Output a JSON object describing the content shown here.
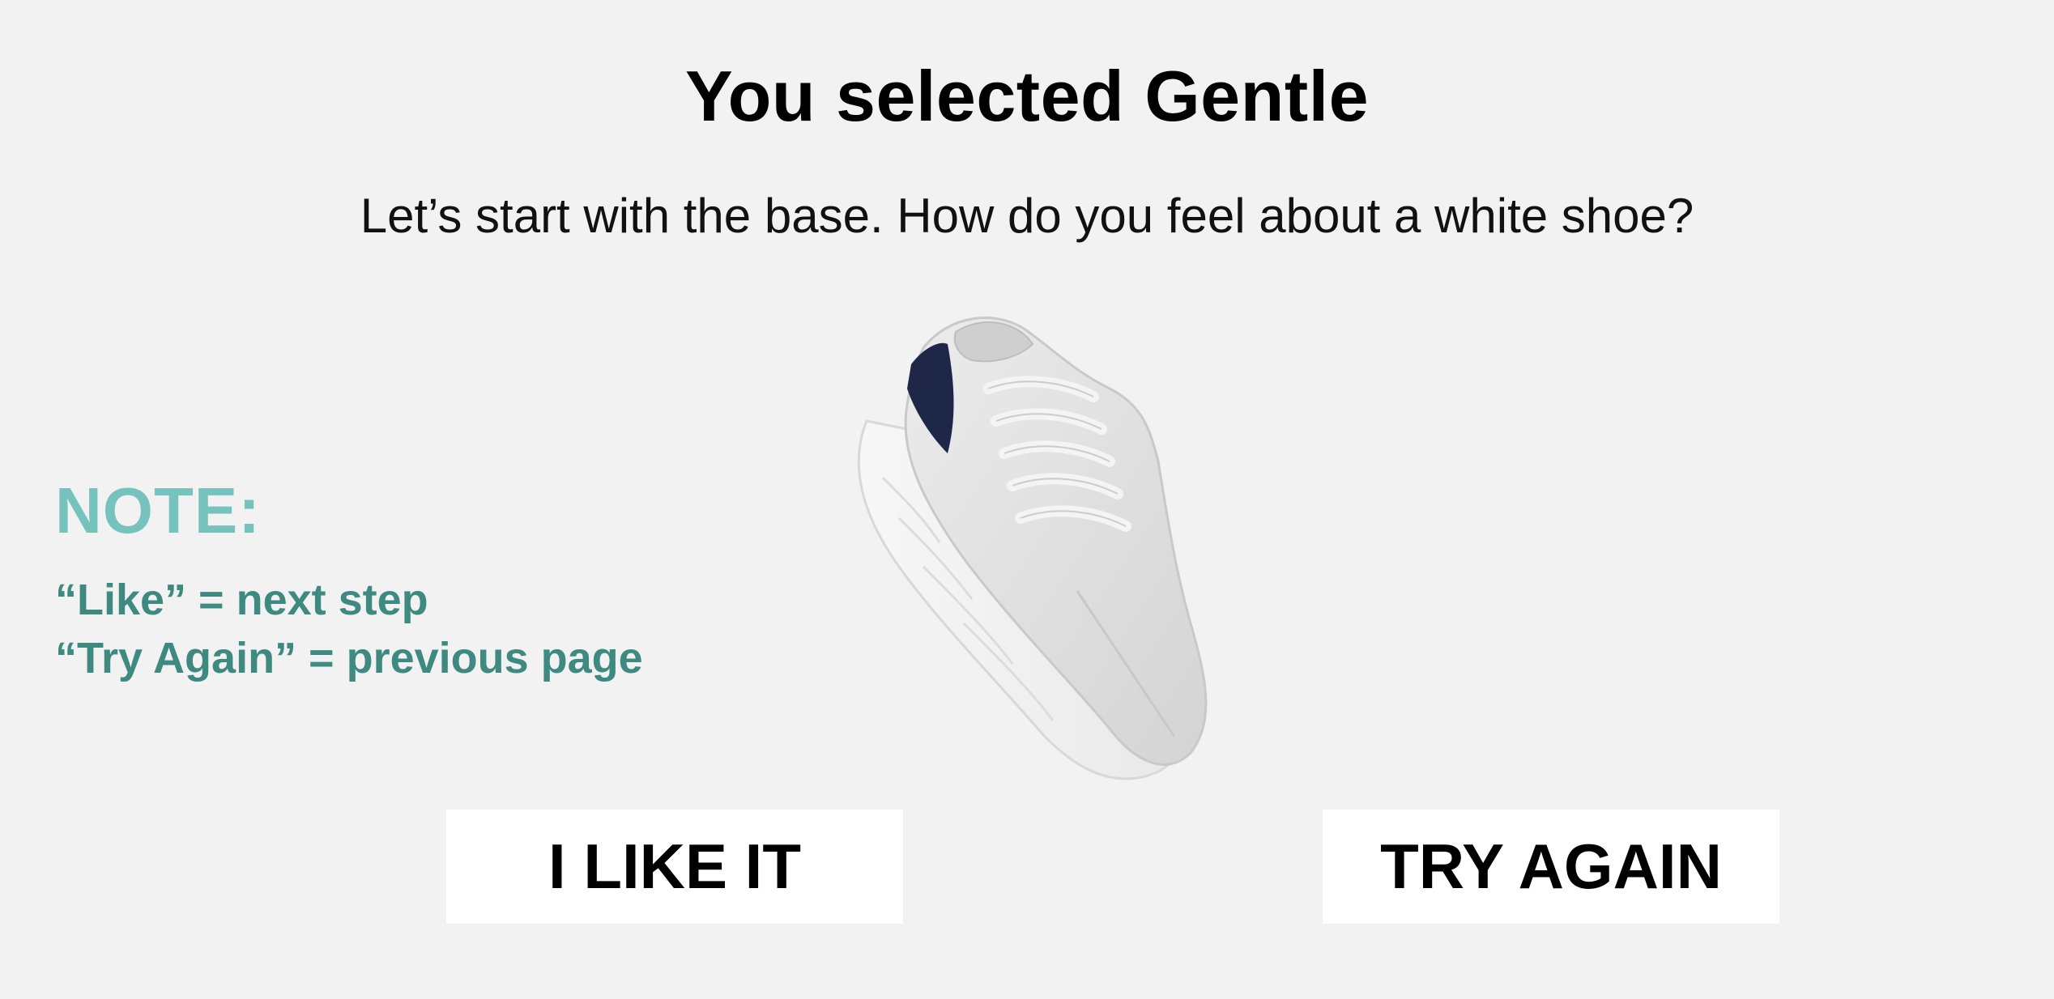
{
  "header": {
    "title": "You selected Gentle",
    "subtitle": "Let’s start with the base. How do you feel about a white shoe?"
  },
  "note": {
    "heading": "NOTE:",
    "line1": "“Like” = next step",
    "line2": "“Try Again” = previous page"
  },
  "product": {
    "icon": "white-sneaker-image",
    "shoe_color": "#e6e6e6",
    "heel_color": "#1f2748"
  },
  "actions": {
    "like_label": "I LIKE IT",
    "try_again_label": "TRY AGAIN"
  },
  "colors": {
    "background": "#f2f2f2",
    "note_heading": "#76c3bd",
    "note_text": "#3f8a80",
    "button_bg": "#ffffff"
  }
}
